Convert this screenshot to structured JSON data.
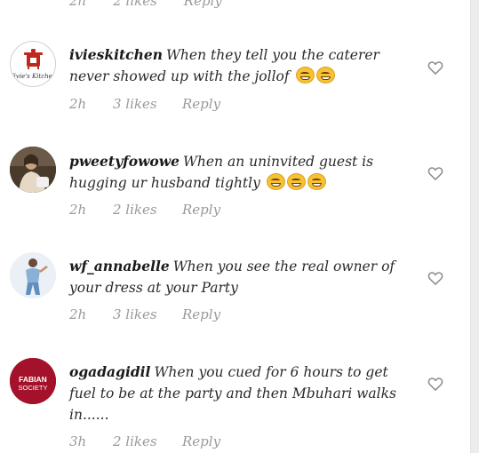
{
  "partial_top": {
    "time": "2h",
    "likes": "2 likes",
    "reply": "Reply"
  },
  "comments": [
    {
      "username": "ivieskitchen",
      "text": "When they tell you the caterer never showed up with the jollof",
      "emojis": [
        "grinning-tears-emoji",
        "grinning-tears-emoji"
      ],
      "time": "2h",
      "likes": "3 likes",
      "reply": "Reply",
      "avatar": {
        "text": "Vivie's Kitchen",
        "bg": "#ffffff",
        "accent": "#c0281d"
      }
    },
    {
      "username": "pweetyfowowe",
      "text": "When an uninvited guest is hugging ur husband tightly",
      "emojis": [
        "grinning-tears-emoji",
        "grinning-tears-emoji",
        "grinning-tears-emoji"
      ],
      "time": "2h",
      "likes": "2 likes",
      "reply": "Reply",
      "avatar": {
        "bg": "#4a3a2c",
        "accent": "#e5d8c4"
      }
    },
    {
      "username": "wf_annabelle",
      "text": "When you see the real owner of your dress at your Party",
      "emojis": [],
      "time": "2h",
      "likes": "3 likes",
      "reply": "Reply",
      "avatar": {
        "bg": "#eaf0f6",
        "accent": "#8ab0d6"
      }
    },
    {
      "username": "ogadagidil",
      "text": "When you cued for 6 hours to get fuel to be at the party and then Mbuhari walks in......",
      "emojis": [],
      "time": "3h",
      "likes": "2 likes",
      "reply": "Reply",
      "avatar": {
        "line1": "FABIAN",
        "line2": "SOCIETY",
        "bg": "#a3112a",
        "accent": "#ffffff"
      }
    }
  ],
  "colors": {
    "text": "#2a2a2a",
    "meta": "#9a9a9a",
    "heart": "#8a8a8a"
  },
  "icons": {
    "like": "heart-outline-icon"
  }
}
